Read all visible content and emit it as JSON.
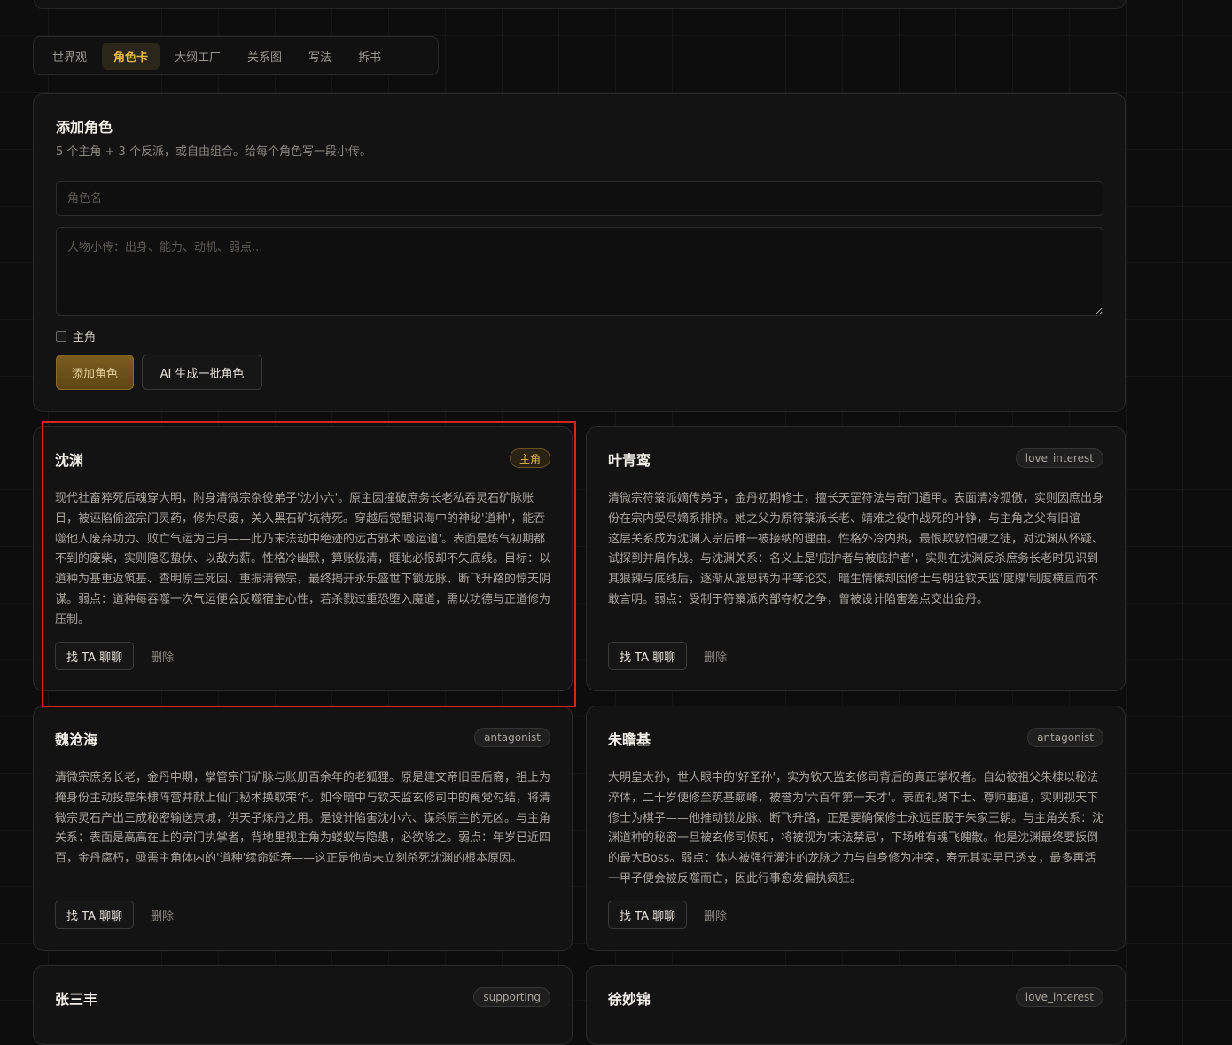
{
  "tabs": [
    {
      "label": "世界观",
      "active": false
    },
    {
      "label": "角色卡",
      "active": true
    },
    {
      "label": "大纲工厂",
      "active": false
    },
    {
      "label": "关系图",
      "active": false
    },
    {
      "label": "写法",
      "active": false
    },
    {
      "label": "拆书",
      "active": false
    }
  ],
  "add_panel": {
    "title": "添加角色",
    "subtitle": "5 个主角 + 3 个反派，或自由组合。给每个角色写一段小传。",
    "name_placeholder": "角色名",
    "bio_placeholder": "人物小传：出身、能力、动机、弱点...",
    "protagonist_checkbox_label": "主角",
    "add_button": "添加角色",
    "ai_button": "AI 生成一批角色"
  },
  "cards": [
    {
      "name": "沈渊",
      "badge": "主角",
      "bio": "现代社畜猝死后魂穿大明，附身清微宗杂役弟子'沈小六'。原主因撞破庶务长老私吞灵石矿脉账目，被诬陷偷盗宗门灵药，修为尽废，关入黑石矿坑待死。穿越后觉醒识海中的神秘'道种'，能吞噬他人废弃功力、败亡气运为己用——此乃末法劫中绝迹的远古邪术'噬运道'。表面是炼气初期都不到的废柴，实则隐忍蛰伏、以敌为薪。性格冷幽默，算账极清，睚眦必报却不失底线。目标：以道种为基重返筑基、查明原主死因、重振清微宗，最终揭开永乐盛世下锁龙脉、断飞升路的惊天阴谋。弱点：道种每吞噬一次气运便会反噬宿主心性，若杀戮过重恐堕入魔道，需以功德与正道修为压制。",
      "chat_label": "找 TA 聊聊",
      "delete_label": "删除"
    },
    {
      "name": "叶青鸾",
      "badge": "love_interest",
      "bio": "清微宗符箓派嫡传弟子，金丹初期修士，擅长天罡符法与奇门遁甲。表面清冷孤傲，实则因庶出身份在宗内受尽嫡系排挤。她之父为原符箓派长老、靖难之役中战死的叶铮，与主角之父有旧谊——这层关系成为沈渊入宗后唯一被接纳的理由。性格外冷内热，最恨欺软怕硬之徒，对沈渊从怀疑、试探到并肩作战。与沈渊关系：名义上是'庇护者与被庇护者'，实则在沈渊反杀庶务长老时见识到其狠辣与底线后，逐渐从施恩转为平等论交，暗生情愫却因修士与朝廷钦天监'度牒'制度横亘而不敢言明。弱点：受制于符箓派内部夺权之争，曾被设计陷害差点交出金丹。",
      "chat_label": "找 TA 聊聊",
      "delete_label": "删除"
    },
    {
      "name": "魏沧海",
      "badge": "antagonist",
      "bio": "清微宗庶务长老，金丹中期，掌管宗门矿脉与账册百余年的老狐狸。原是建文帝旧臣后裔，祖上为掩身份主动投靠朱棣阵营并献上仙门秘术换取荣华。如今暗中与钦天监玄修司中的阉党勾结，将清微宗灵石产出三成秘密输送京城，供天子炼丹之用。是设计陷害沈小六、谋杀原主的元凶。与主角关系：表面是高高在上的宗门执掌者，背地里视主角为蝼蚁与隐患，必欲除之。弱点：年岁已近四百，金丹腐朽，亟需主角体内的'道种'续命延寿——这正是他尚未立刻杀死沈渊的根本原因。",
      "chat_label": "找 TA 聊聊",
      "delete_label": "删除"
    },
    {
      "name": "朱瞻基",
      "badge": "antagonist",
      "bio": "大明皇太孙，世人眼中的'好圣孙'，实为钦天监玄修司背后的真正掌权者。自幼被祖父朱棣以秘法淬体，二十岁便修至筑基巅峰，被誉为'六百年第一天才'。表面礼贤下士、尊师重道，实则视天下修士为棋子——他推动锁龙脉、断飞升路，正是要确保修士永远臣服于朱家王朝。与主角关系：沈渊道种的秘密一旦被玄修司侦知，将被视为'末法禁忌'，下场唯有魂飞魄散。他是沈渊最终要扳倒的最大Boss。弱点：体内被强行灌注的龙脉之力与自身修为冲突，寿元其实早已透支，最多再活一甲子便会被反噬而亡，因此行事愈发偏执疯狂。",
      "chat_label": "找 TA 聊聊",
      "delete_label": "删除"
    },
    {
      "name": "张三丰",
      "badge": "supporting"
    },
    {
      "name": "徐妙锦",
      "badge": "love_interest"
    }
  ]
}
